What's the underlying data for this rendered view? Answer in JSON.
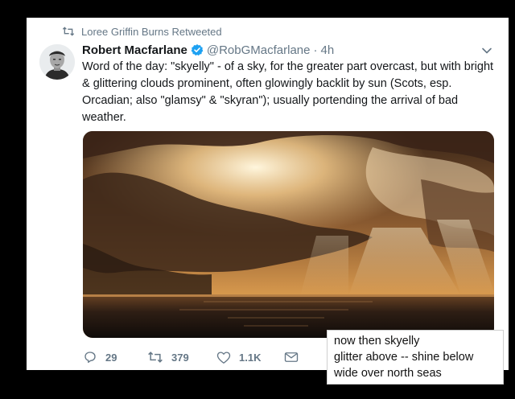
{
  "retweet_context": {
    "icon": "retweet-icon",
    "text": "Loree Griffin Burns Retweeted"
  },
  "tweet": {
    "author_name": "Robert Macfarlane",
    "verified_icon": "verified-badge-icon",
    "handle": "@RobGMacfarlane",
    "separator": "·",
    "time": "4h",
    "text": "Word of the day: \"skyelly\" - of a sky, for the greater part overcast, but with bright & glittering clouds prominent, often glowingly backlit by sun (Scots, esp. Orcadian; also \"glamsy\" & \"skyran\"); usually portending the arrival of bad weather.",
    "accent_color": "#1da1f2"
  },
  "actions": {
    "reply_count": "29",
    "retweet_count": "379",
    "like_count": "1.1K"
  },
  "poem_overlay": {
    "lines": [
      "now then skyelly",
      "glitter above -- shine below",
      "wide over north seas"
    ]
  }
}
